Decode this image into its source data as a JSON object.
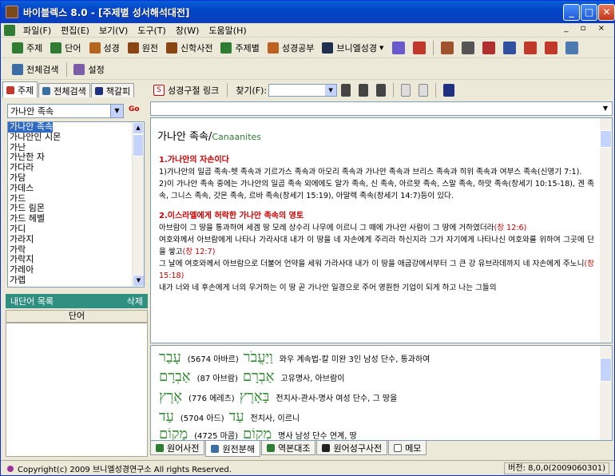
{
  "window": {
    "title": "바이블렉스 8.0 - [주제별 성서해석대전]",
    "controls": [
      "_",
      "□",
      "✕"
    ]
  },
  "menu": [
    "파일(F)",
    "편집(E)",
    "보기(V)",
    "도구(T)",
    "창(W)",
    "도움말(H)"
  ],
  "mdi_controls": "_ ▫ ×",
  "toolbar1": [
    {
      "label": "주제",
      "icon": "green-bracket-icon",
      "color": "#2e7d32"
    },
    {
      "label": "단어",
      "icon": "green-bracket-icon",
      "color": "#2e7d32"
    },
    {
      "label": "성경",
      "icon": "book-icon",
      "color": "#b5651d"
    },
    {
      "label": "원전",
      "icon": "book-icon",
      "color": "#8b4513"
    },
    {
      "label": "신학사전",
      "icon": "book-icon",
      "color": "#8b4513"
    },
    {
      "label": "주제별",
      "icon": "book-icon",
      "color": "#2e7d32"
    },
    {
      "label": "성경공부",
      "icon": "book-icon",
      "color": "#c06020"
    },
    {
      "label": "브니엘성경",
      "icon": "book-icon",
      "color": "#203050"
    }
  ],
  "toolbar2": [
    {
      "label": "전체검색",
      "icon": "search-icon"
    },
    {
      "label": "설정",
      "icon": "settings-icon"
    }
  ],
  "left": {
    "tabs": [
      "주제",
      "전체검색",
      "책갈피"
    ],
    "combo_value": "가나안 족속",
    "words": [
      "가나안 족속",
      "가나안인 시몬",
      "가난",
      "가난한 자",
      "가다라",
      "가담",
      "가데스",
      "가드",
      "가드 림몬",
      "가드 헤벨",
      "가디",
      "가라지",
      "가락",
      "가락지",
      "가레아",
      "가렙"
    ],
    "selected": "가나안 족속",
    "inner_title": "내단어 목록",
    "inner_delete": "삭제",
    "inner_header": "단어"
  },
  "right": {
    "link_label": "성경구절 링크",
    "find_label": "찾기(F):",
    "find_value": "",
    "title_ko": "가나안 족속/",
    "title_en": "Canaanites",
    "sec1_title": "1.가나안의 자손이다",
    "sec1_p1": "1)가나안의 일곱 족속-헷 족속과 기르가스 족속과 아모리 족속과 가나안 족속과 브리스 족속과 히위 족속과 여부스 족속(신명기 7:1).",
    "sec1_p2": "2)이 가나안 족속 중에는 가나안의 일곱 족속 외에에도 알가 족속, 신 족속, 아르왓 족속, 스말 족속, 하맛 족속(창세기 10:15-18), 겐 족속, 그니스 족속, 갓몬 족속, 르바 족속(창세기 15:19), 아말렉 족속(창세기 14:7)등이 있다.",
    "sec2_title": "2.이스라엘에게 허락한 가나안 족속의 영토",
    "sec2_p1": "아브람이 그 땅을 통과하여 세겜 땅 모레 상수리 나무에 이르니 그 때에 가나안 사람이 그 땅에 거하였더라",
    "sec2_r1": "(창 12:6)",
    "sec2_p2": "여호와께서 아브람에게 나타나 가라사대 내가 이 땅을 네 자손에게 주리라 하신지라 그가 자기에게 나타나신 여호와를 위하여 그곳에 단을 쌓고",
    "sec2_r2": "(창 12:7)",
    "sec2_p3": "그 날에 여호와께서 아브람으로 더불어 언약을 세워 가라사대 내가 이 땅을 애굽강에서부터 그 큰 강 유브라데까지 네 자손에게 주노니",
    "sec2_r3": "(창 15:18)",
    "sec2_p4": "내가 너와 네 후손에게 너의 우거하는 이 땅 곧 가나안 일경으로 주어 영원한 기업이 되게 하고 나는 그들의"
  },
  "original": [
    {
      "heb": "עָבַר",
      "code": "(5674 아바르)",
      "heb2": "וַיַּעֲבֹר",
      "gloss": "와우 계속법-칼 미완 3인 남성 단수, 통과하여"
    },
    {
      "heb": "אַבְרָם",
      "code": "(87 아브람)",
      "heb2": "אַבְרָם",
      "gloss": "고유명사, 아브람이"
    },
    {
      "heb": "אֶרֶץ",
      "code": "(776 에레츠)",
      "heb2": "בָּאָרֶץ",
      "gloss": "전치사-관사-명사 여성 단수, 그 땅을"
    },
    {
      "heb": "עַד",
      "code": "(5704 아드)",
      "heb2": "עַד",
      "gloss": "전치사, 이르니"
    },
    {
      "heb": "מָקוֹם",
      "code": "(4725 마콤)",
      "heb2": "מְקוֹם",
      "gloss": "명사 남성 단수 연계, 땅"
    }
  ],
  "bottom_tabs": [
    "원어사전",
    "원전분해",
    "역본대조",
    "원어성구사전",
    "메모"
  ],
  "status": {
    "copyright": "Copyright(c) 2009 브니엘성경연구소 All rights Reserved.",
    "version": "버전: 8,0,0(2009060301)"
  }
}
